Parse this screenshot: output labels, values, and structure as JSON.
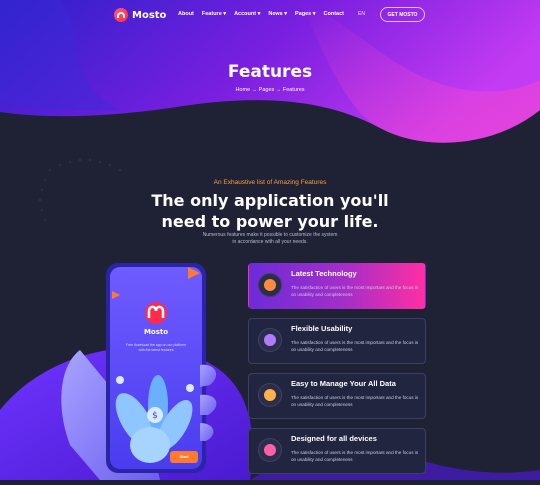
{
  "nav": {
    "logo_text": "Mosto",
    "menu": [
      "About",
      "Feature ▾",
      "Account ▾",
      "News ▾",
      "Pages ▾",
      "Contact"
    ],
    "lang": "EN",
    "cta": "GET MOSTO"
  },
  "hero": {
    "title": "Features",
    "breadcrumb": "Home  →  Pages  →  Features"
  },
  "section": {
    "subtitle": "An Exhaustive list of Amazing Features",
    "headline_line1": "The only application you'll",
    "headline_line2": "need to power your life.",
    "description": "Numerous features make it possible to customize the system in accordance with all your needs."
  },
  "phone": {
    "app_name": "Mosto",
    "app_text": "Free download the app on our platform with the latest features",
    "button": "Start"
  },
  "features": [
    {
      "title": "Latest Technology",
      "desc": "The satisfaction of users is the most important and the focus is on usability and completeness",
      "icon": "technology-icon",
      "active": true
    },
    {
      "title": "Flexible Usability",
      "desc": "The satisfaction of users is the most important and the focus is on usability and completeness",
      "icon": "usability-icon",
      "active": false
    },
    {
      "title": "Easy to Manage Your All Data",
      "desc": "The satisfaction of users is the most important and the focus is on usability and completeness",
      "icon": "data-icon",
      "active": false
    },
    {
      "title": "Designed for all devices",
      "desc": "The satisfaction of users is the most important and the focus is on usability and completeness",
      "icon": "devices-icon",
      "active": false
    }
  ],
  "colors": {
    "accent_orange": "#ff9d3a",
    "purple": "#6c2bd9",
    "pink": "#ff2fa2",
    "background": "#1f2235"
  }
}
